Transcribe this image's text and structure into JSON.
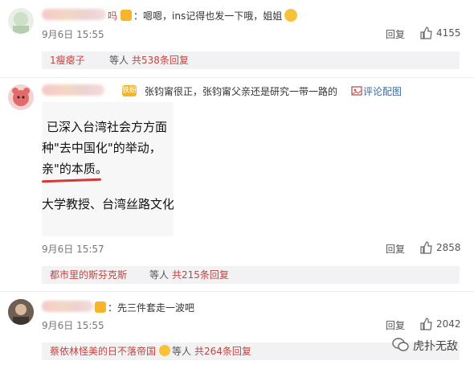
{
  "comments": [
    {
      "name_tail": "吗",
      "text": "：嗯嗯，ins记得也发一下哦，姐姐",
      "time": "9月6日 15:55",
      "reply_label": "回复",
      "likes": "4155",
      "thread": {
        "name": "1瘦瘪子",
        "mid": "等人",
        "count": "共538条回复"
      }
    },
    {
      "badge": "铁粉",
      "text": "张钧甯很正，张钧甯父亲还是研究一带一路的",
      "report_label": "评论配图",
      "image_lines": [
        "已深入台湾社会方方面",
        "种\"去中国化\"的举动，",
        "亲\"的本质。",
        "大学教授、台湾丝路文化"
      ],
      "time": "9月6日 15:57",
      "reply_label": "回复",
      "likes": "2858",
      "thread": {
        "name": "都市里的斯芬克斯",
        "mid": "等人",
        "count": "共215条回复"
      }
    },
    {
      "text": "：先三件套走一波吧",
      "time": "9月6日 15:55",
      "reply_label": "回复",
      "likes": "2042",
      "thread": {
        "name": "蔡依林怪美的日不落帝国",
        "mid": "等人",
        "count": "共264条回复"
      }
    }
  ],
  "watermark": "虎扑无敌",
  "icons": [
    "thumb-up-icon",
    "image-icon",
    "wechat-icon"
  ],
  "colors": {
    "accent": "#c1443f",
    "link": "#3b6aa8",
    "badge": "#f3b52a"
  }
}
